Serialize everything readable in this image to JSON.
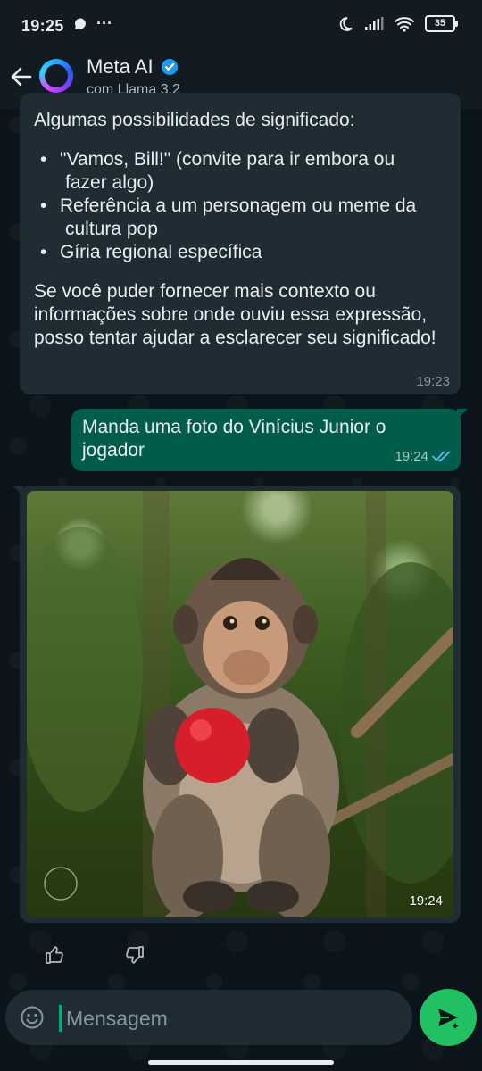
{
  "status_bar": {
    "time": "19:25",
    "more": "···",
    "battery": "35"
  },
  "header": {
    "title": "Meta AI",
    "subtitle": "com Llama 3.2"
  },
  "messages": {
    "incoming_1": {
      "intro": "Algumas possibilidades de significado:",
      "bullets": [
        {
          "line1": "\"Vamos, Bill!\" (convite para ir embora ou",
          "line2": "fazer algo)"
        },
        {
          "line1": "Referência a um personagem ou meme da",
          "line2": "cultura pop"
        },
        {
          "line1": "Gíria regional específica",
          "line2": ""
        }
      ],
      "closing": "Se você puder fornecer mais contexto ou informações sobre onde ouviu essa expressão, posso tentar ajudar a esclarecer seu significado!",
      "time": "19:23"
    },
    "outgoing_1": {
      "text": "Manda uma foto do Vinícius Junior o jogador",
      "time": "19:24"
    },
    "incoming_image": {
      "time": "19:24"
    }
  },
  "composer": {
    "placeholder": "Mensagem"
  },
  "colors": {
    "background": "#0b141a",
    "bubble_in": "#202c33",
    "bubble_out": "#005c4b",
    "accent": "#21c063",
    "verified": "#1d9bf0"
  },
  "icons": {
    "back": "arrow-left-icon",
    "verified": "verified-badge-icon",
    "thumbs_up": "thumbs-up-icon",
    "thumbs_down": "thumbs-down-icon",
    "emoji": "emoji-icon",
    "send": "send-icon"
  }
}
